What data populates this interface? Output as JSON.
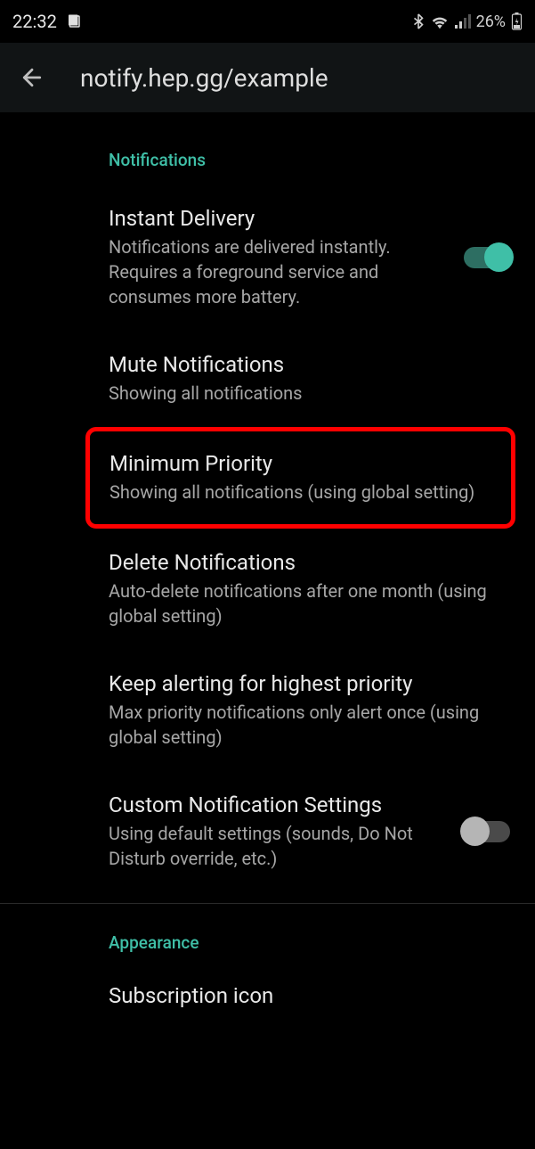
{
  "status_bar": {
    "time": "22:32",
    "battery_pct": "26%"
  },
  "header": {
    "title": "notify.hep.gg/example"
  },
  "sections": {
    "notifications": {
      "label": "Notifications",
      "items": {
        "instant_delivery": {
          "title": "Instant Delivery",
          "desc": "Notifications are delivered instantly. Requires a foreground service and consumes more battery.",
          "toggle_on": true
        },
        "mute": {
          "title": "Mute Notifications",
          "desc": "Showing all notifications"
        },
        "min_priority": {
          "title": "Minimum Priority",
          "desc": "Showing all notifications (using global setting)"
        },
        "delete": {
          "title": "Delete Notifications",
          "desc": "Auto-delete notifications after one month (using global setting)"
        },
        "keep_alerting": {
          "title": "Keep alerting for highest priority",
          "desc": "Max priority notifications only alert once (using global setting)"
        },
        "custom": {
          "title": "Custom Notification Settings",
          "desc": "Using default settings (sounds, Do Not Disturb override, etc.)",
          "toggle_on": false
        }
      }
    },
    "appearance": {
      "label": "Appearance",
      "items": {
        "subscription_icon": {
          "title": "Subscription icon"
        }
      }
    }
  }
}
